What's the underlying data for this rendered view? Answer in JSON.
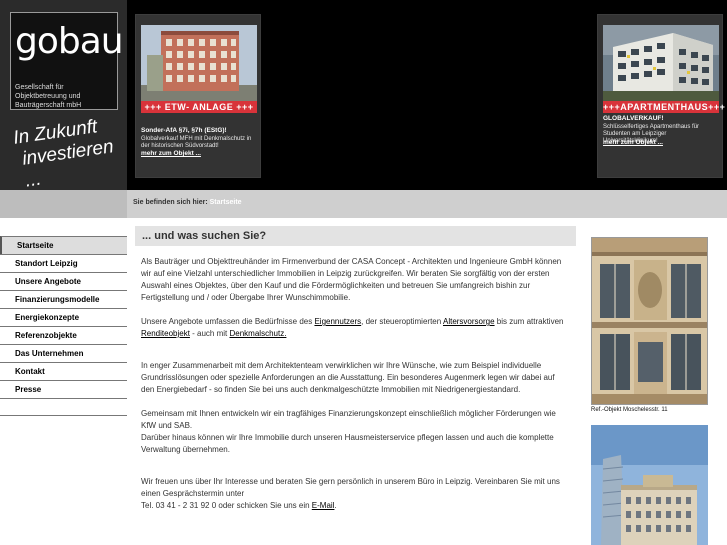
{
  "brand": {
    "logo": "gobau",
    "subline": "Gesellschaft für Objektbetreuung und Bauträgerschaft mbH",
    "slogan_line1": "In Zukunft",
    "slogan_line2": "investieren ..."
  },
  "offers": [
    {
      "band": "+++ ETW- ANLAGE +++",
      "title": "Sonder-AfA §7i, §7h (EStG)!",
      "text": "Globalverkauf MFH mit Denkmalschutz in der historischen Südvorstadt!",
      "more": "mehr zum Objekt ..."
    },
    {
      "band": "+++APARTMENTHAUS+++",
      "title": "GLOBALVERKAUF!",
      "text": "Schlüsselfertiges Apartmenthaus für Studenten am Leipziger Universitätsklinikum!",
      "more": "mehr zum Objekt ..."
    }
  ],
  "breadcrumb": {
    "label": "Sie befinden sich hier:",
    "current": "Startseite"
  },
  "nav": {
    "items": [
      "Startseite",
      "Standort Leipzig",
      "Unsere Angebote",
      "Finanzierungsmodelle",
      "Energiekonzepte",
      "Referenzobjekte",
      "Das Unternehmen",
      "Kontakt",
      "Presse"
    ]
  },
  "main": {
    "title": "... und was suchen Sie?",
    "p1": "Als Bauträger und Objekttreuhänder im Firmenverbund der CASA Concept - Architekten und Ingenieure GmbH können wir auf eine Vielzahl unterschiedlicher Immobilien in Leipzig zurückgreifen. Wir beraten Sie sorgfältig von der ersten Auswahl eines Objektes, über den Kauf und die Fördermöglichkeiten und betreuen Sie umfangreich bishin zur Fertigstellung und / oder Übergabe Ihrer Wunschimmobilie.",
    "p2": {
      "t1": "Unsere Angebote umfassen die Bedürfnisse des ",
      "l1": "Eigennutzers",
      "t2": ", der steueroptimierten ",
      "l2": "Altersvorsorge",
      "t3": " bis zum attraktiven ",
      "l3": "Renditeobjekt",
      "t4": " - auch mit ",
      "l4": "Denkmalschutz."
    },
    "p3": "In enger Zusammenarbeit mit dem Architektenteam verwirklichen wir Ihre Wünsche, wie zum Beispiel individuelle Grundrisslösungen oder spezielle Anforderungen an die Ausstattung. Ein besonderes Augenmerk legen wir dabei auf den Energiebedarf - so finden Sie bei uns auch denkmalgeschützte Immobilien mit Niedrigenergiestandard.",
    "p4a": "Gemeinsam mit Ihnen entwickeln wir ein tragfähiges Finanzierungskonzept einschließlich möglicher Förderungen wie KfW und SAB.",
    "p4b": "Darüber hinaus können wir Ihre Immobilie durch unseren Hausmeisterservice pflegen lassen und auch die komplette Verwaltung übernehmen.",
    "p5": {
      "t1": "Wir freuen uns über Ihr Interesse und beraten Sie gern persönlich in unserem Büro in Leipzig. Vereinbaren Sie mit uns einen Gesprächstermin unter",
      "t2": "Tel. 03 41 - 2 31 92 0 oder schicken Sie uns ein ",
      "l1": "E-Mail",
      "t3": "."
    }
  },
  "sidebar": {
    "caption": "Ref.-Objekt Moschelesstr. 11"
  },
  "colors": {
    "header_bg": "#000000",
    "band_red": "#d8333a",
    "crumb_bar": "#cfcfcf",
    "title_bar": "#e3e3e3"
  }
}
